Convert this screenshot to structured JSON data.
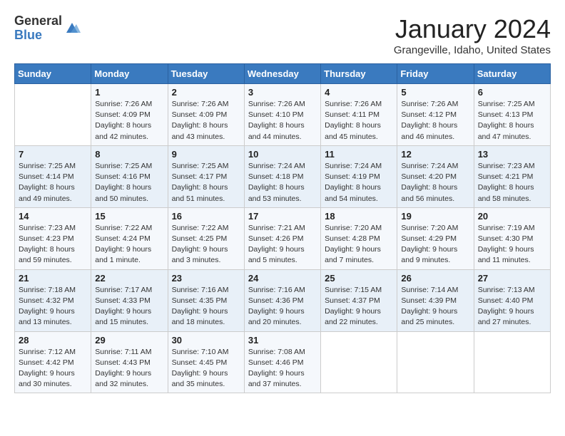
{
  "logo": {
    "general": "General",
    "blue": "Blue"
  },
  "title": "January 2024",
  "location": "Grangeville, Idaho, United States",
  "days_of_week": [
    "Sunday",
    "Monday",
    "Tuesday",
    "Wednesday",
    "Thursday",
    "Friday",
    "Saturday"
  ],
  "weeks": [
    [
      {
        "day": "",
        "sunrise": "",
        "sunset": "",
        "daylight": ""
      },
      {
        "day": "1",
        "sunrise": "Sunrise: 7:26 AM",
        "sunset": "Sunset: 4:09 PM",
        "daylight": "Daylight: 8 hours and 42 minutes."
      },
      {
        "day": "2",
        "sunrise": "Sunrise: 7:26 AM",
        "sunset": "Sunset: 4:09 PM",
        "daylight": "Daylight: 8 hours and 43 minutes."
      },
      {
        "day": "3",
        "sunrise": "Sunrise: 7:26 AM",
        "sunset": "Sunset: 4:10 PM",
        "daylight": "Daylight: 8 hours and 44 minutes."
      },
      {
        "day": "4",
        "sunrise": "Sunrise: 7:26 AM",
        "sunset": "Sunset: 4:11 PM",
        "daylight": "Daylight: 8 hours and 45 minutes."
      },
      {
        "day": "5",
        "sunrise": "Sunrise: 7:26 AM",
        "sunset": "Sunset: 4:12 PM",
        "daylight": "Daylight: 8 hours and 46 minutes."
      },
      {
        "day": "6",
        "sunrise": "Sunrise: 7:25 AM",
        "sunset": "Sunset: 4:13 PM",
        "daylight": "Daylight: 8 hours and 47 minutes."
      }
    ],
    [
      {
        "day": "7",
        "sunrise": "Sunrise: 7:25 AM",
        "sunset": "Sunset: 4:14 PM",
        "daylight": "Daylight: 8 hours and 49 minutes."
      },
      {
        "day": "8",
        "sunrise": "Sunrise: 7:25 AM",
        "sunset": "Sunset: 4:16 PM",
        "daylight": "Daylight: 8 hours and 50 minutes."
      },
      {
        "day": "9",
        "sunrise": "Sunrise: 7:25 AM",
        "sunset": "Sunset: 4:17 PM",
        "daylight": "Daylight: 8 hours and 51 minutes."
      },
      {
        "day": "10",
        "sunrise": "Sunrise: 7:24 AM",
        "sunset": "Sunset: 4:18 PM",
        "daylight": "Daylight: 8 hours and 53 minutes."
      },
      {
        "day": "11",
        "sunrise": "Sunrise: 7:24 AM",
        "sunset": "Sunset: 4:19 PM",
        "daylight": "Daylight: 8 hours and 54 minutes."
      },
      {
        "day": "12",
        "sunrise": "Sunrise: 7:24 AM",
        "sunset": "Sunset: 4:20 PM",
        "daylight": "Daylight: 8 hours and 56 minutes."
      },
      {
        "day": "13",
        "sunrise": "Sunrise: 7:23 AM",
        "sunset": "Sunset: 4:21 PM",
        "daylight": "Daylight: 8 hours and 58 minutes."
      }
    ],
    [
      {
        "day": "14",
        "sunrise": "Sunrise: 7:23 AM",
        "sunset": "Sunset: 4:23 PM",
        "daylight": "Daylight: 8 hours and 59 minutes."
      },
      {
        "day": "15",
        "sunrise": "Sunrise: 7:22 AM",
        "sunset": "Sunset: 4:24 PM",
        "daylight": "Daylight: 9 hours and 1 minute."
      },
      {
        "day": "16",
        "sunrise": "Sunrise: 7:22 AM",
        "sunset": "Sunset: 4:25 PM",
        "daylight": "Daylight: 9 hours and 3 minutes."
      },
      {
        "day": "17",
        "sunrise": "Sunrise: 7:21 AM",
        "sunset": "Sunset: 4:26 PM",
        "daylight": "Daylight: 9 hours and 5 minutes."
      },
      {
        "day": "18",
        "sunrise": "Sunrise: 7:20 AM",
        "sunset": "Sunset: 4:28 PM",
        "daylight": "Daylight: 9 hours and 7 minutes."
      },
      {
        "day": "19",
        "sunrise": "Sunrise: 7:20 AM",
        "sunset": "Sunset: 4:29 PM",
        "daylight": "Daylight: 9 hours and 9 minutes."
      },
      {
        "day": "20",
        "sunrise": "Sunrise: 7:19 AM",
        "sunset": "Sunset: 4:30 PM",
        "daylight": "Daylight: 9 hours and 11 minutes."
      }
    ],
    [
      {
        "day": "21",
        "sunrise": "Sunrise: 7:18 AM",
        "sunset": "Sunset: 4:32 PM",
        "daylight": "Daylight: 9 hours and 13 minutes."
      },
      {
        "day": "22",
        "sunrise": "Sunrise: 7:17 AM",
        "sunset": "Sunset: 4:33 PM",
        "daylight": "Daylight: 9 hours and 15 minutes."
      },
      {
        "day": "23",
        "sunrise": "Sunrise: 7:16 AM",
        "sunset": "Sunset: 4:35 PM",
        "daylight": "Daylight: 9 hours and 18 minutes."
      },
      {
        "day": "24",
        "sunrise": "Sunrise: 7:16 AM",
        "sunset": "Sunset: 4:36 PM",
        "daylight": "Daylight: 9 hours and 20 minutes."
      },
      {
        "day": "25",
        "sunrise": "Sunrise: 7:15 AM",
        "sunset": "Sunset: 4:37 PM",
        "daylight": "Daylight: 9 hours and 22 minutes."
      },
      {
        "day": "26",
        "sunrise": "Sunrise: 7:14 AM",
        "sunset": "Sunset: 4:39 PM",
        "daylight": "Daylight: 9 hours and 25 minutes."
      },
      {
        "day": "27",
        "sunrise": "Sunrise: 7:13 AM",
        "sunset": "Sunset: 4:40 PM",
        "daylight": "Daylight: 9 hours and 27 minutes."
      }
    ],
    [
      {
        "day": "28",
        "sunrise": "Sunrise: 7:12 AM",
        "sunset": "Sunset: 4:42 PM",
        "daylight": "Daylight: 9 hours and 30 minutes."
      },
      {
        "day": "29",
        "sunrise": "Sunrise: 7:11 AM",
        "sunset": "Sunset: 4:43 PM",
        "daylight": "Daylight: 9 hours and 32 minutes."
      },
      {
        "day": "30",
        "sunrise": "Sunrise: 7:10 AM",
        "sunset": "Sunset: 4:45 PM",
        "daylight": "Daylight: 9 hours and 35 minutes."
      },
      {
        "day": "31",
        "sunrise": "Sunrise: 7:08 AM",
        "sunset": "Sunset: 4:46 PM",
        "daylight": "Daylight: 9 hours and 37 minutes."
      },
      {
        "day": "",
        "sunrise": "",
        "sunset": "",
        "daylight": ""
      },
      {
        "day": "",
        "sunrise": "",
        "sunset": "",
        "daylight": ""
      },
      {
        "day": "",
        "sunrise": "",
        "sunset": "",
        "daylight": ""
      }
    ]
  ]
}
